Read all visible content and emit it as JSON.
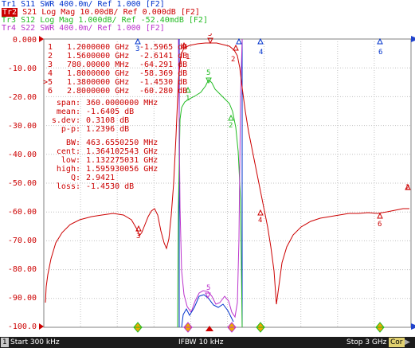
{
  "traces": [
    {
      "id": "Tr1",
      "param": "S11",
      "format": "SWR",
      "scale": "400.0m/",
      "ref": "Ref 1.000",
      "tag": "[F2]",
      "color": "#0033cc",
      "active": false
    },
    {
      "id": "Tr2",
      "param": "S21",
      "format": "Log Mag",
      "scale": "10.00dB/",
      "ref": "Ref 0.000dB",
      "tag": "[F2]",
      "color": "#cc0000",
      "active": true
    },
    {
      "id": "Tr3",
      "param": "S12",
      "format": "Log Mag",
      "scale": "1.000dB/",
      "ref": "Ref -52.40mdB",
      "tag": "[F2]",
      "color": "#22bb22",
      "active": false
    },
    {
      "id": "Tr4",
      "param": "S22",
      "format": "SWR",
      "scale": "400.0m/",
      "ref": "Ref 1.000",
      "tag": "[F2]",
      "color": "#bb33cc",
      "active": false
    }
  ],
  "y_axis_labels": [
    "0.000",
    "-10.00",
    "-20.00",
    "-30.00",
    "-40.00",
    "-50.00",
    "-60.00",
    "-70.00",
    "-80.00",
    "-90.00",
    "-100.0"
  ],
  "marker_readout": [
    {
      "num": "1",
      "active": false,
      "freq": "1.2000000 GHz",
      "value": "-1.5965 dB"
    },
    {
      "num": "2",
      "active": false,
      "freq": "1.5600000 GHz",
      "value": "-2.6141 dB"
    },
    {
      "num": "3",
      "active": false,
      "freq": "780.00000 MHz",
      "value": "-64.291 dB"
    },
    {
      "num": "4",
      "active": false,
      "freq": "1.8000000 GHz",
      "value": "-58.369 dB"
    },
    {
      "num": "5",
      "active": true,
      "freq": "1.3800000 GHz",
      "value": "-1.4530 dB"
    },
    {
      "num": "6",
      "active": false,
      "freq": "2.8000000 GHz",
      "value": "-60.280 dB"
    }
  ],
  "stats": [
    {
      "label": "span:",
      "value": "360.0000000 MHz"
    },
    {
      "label": "mean:",
      "value": "-1.6405 dB"
    },
    {
      "label": "s.dev:",
      "value": "0.3108 dB"
    },
    {
      "label": "p-p:",
      "value": "1.2396 dB"
    }
  ],
  "bandwidth": [
    {
      "label": "BW:",
      "value": "463.6550250 MHz"
    },
    {
      "label": "cent:",
      "value": "1.364102543 GHz"
    },
    {
      "label": "low:",
      "value": "1.132275031 GHz"
    },
    {
      "label": "high:",
      "value": "1.595930056 GHz"
    },
    {
      "label": "Q:",
      "value": "2.9421"
    },
    {
      "label": "loss:",
      "value": "-1.4530 dB"
    }
  ],
  "right_axis_marker_label": "2",
  "status_bar": {
    "channel": "1",
    "start": "Start 300 kHz",
    "ifbw": "IFBW 10 kHz",
    "stop": "Stop 3 GHz",
    "cor": "Cor"
  },
  "colors": {
    "tr1": "#0033cc",
    "tr2": "#cc0000",
    "tr3": "#22bb22",
    "tr4": "#bb33cc",
    "background": "#ffffff",
    "grid": "#c0c0c0"
  }
}
